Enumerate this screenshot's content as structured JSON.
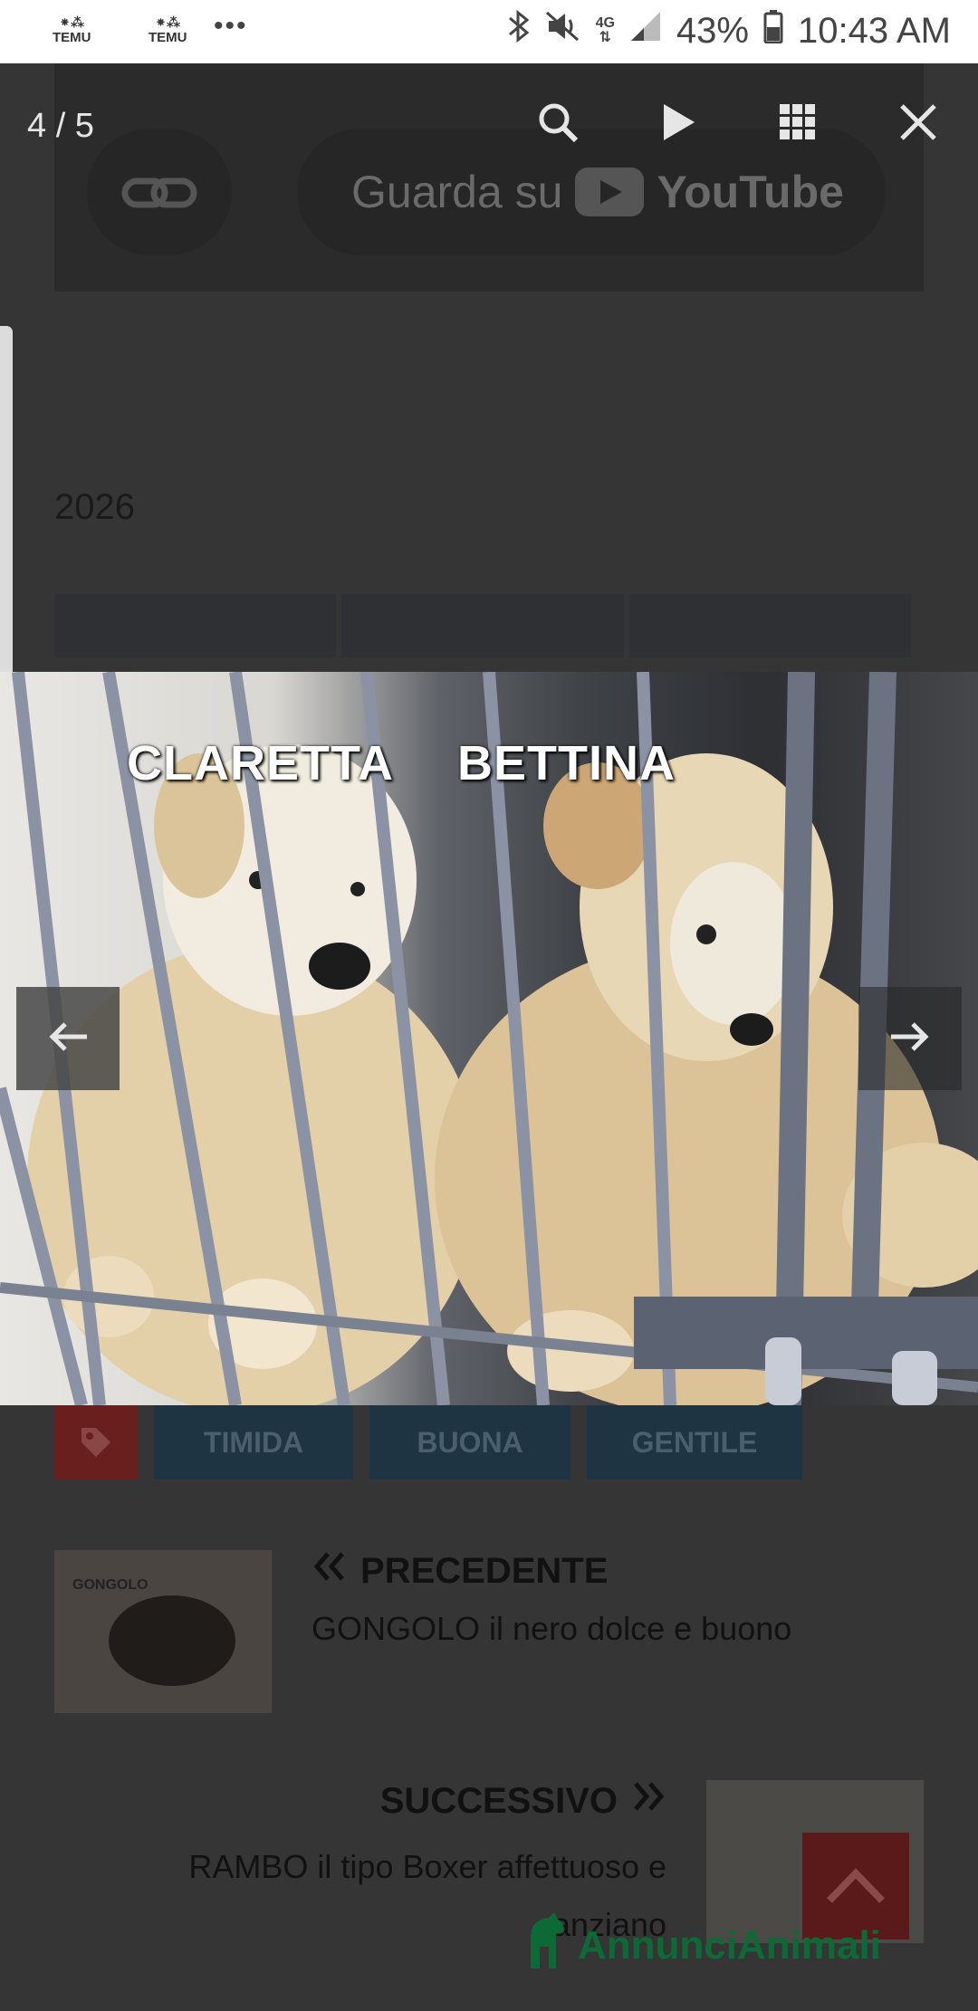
{
  "status_bar": {
    "apps": [
      "TEMU",
      "TEMU"
    ],
    "overflow": "•••",
    "network": "4G",
    "battery": "43%",
    "time": "10:43 AM"
  },
  "background_page": {
    "video": {
      "watch_text": "Guarda su",
      "brand": "YouTube"
    },
    "year": "2026",
    "tags": [
      "TIMIDA",
      "BUONA",
      "GENTILE"
    ],
    "previous": {
      "heading": "PRECEDENTE",
      "title": "GONGOLO il nero dolce e buono",
      "thumb_label": "GONGOLO"
    },
    "next": {
      "heading": "SUCCESSIVO",
      "title": "RAMBO il tipo Boxer affettuoso e anziano"
    },
    "brand": "AnnunciAnimali"
  },
  "gallery": {
    "counter": "4 / 5",
    "photo_labels": [
      "CLARETTA",
      "BETTINA"
    ],
    "icons": {
      "search": "search-icon",
      "play": "play-icon",
      "grid": "grid-icon",
      "close": "close-icon",
      "prev": "arrow-left-icon",
      "next": "arrow-right-icon"
    }
  },
  "colors": {
    "overlay": "#353535",
    "tag_bg": "#1f3442",
    "accent_red": "#6a1f1f",
    "brand_green": "#0d6a36"
  }
}
